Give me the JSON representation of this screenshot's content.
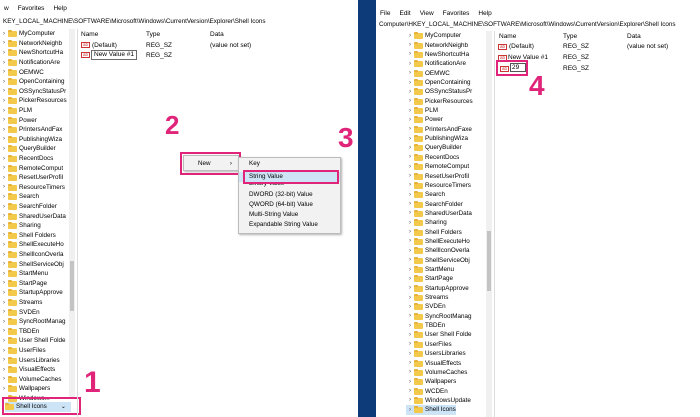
{
  "left": {
    "menu": [
      "w",
      "Favorites",
      "Help"
    ],
    "address": "KEY_LOCAL_MACHINE\\SOFTWARE\\Microsoft\\Windows\\CurrentVersion\\Explorer\\Shell Icons",
    "tree": [
      "MyComputer",
      "NetworkNeighb",
      "NewShortcutHa",
      "NotificationAre",
      "OEMWC",
      "OpenContaining",
      "OSSyncStatusPr",
      "PickerResources",
      "PLM",
      "Power",
      "PrintersAndFax",
      "PublishingWiza",
      "QueryBuilder",
      "RecentDocs",
      "RemoteComput",
      "ResetUserProfil",
      "ResourceTimers",
      "Search",
      "SearchFolder",
      "SharedUserData",
      "Sharing",
      "Shell Folders",
      "ShellExecuteHo",
      "ShellIconOverla",
      "ShellServiceObj",
      "StartMenu",
      "StartPage",
      "StartupApprove",
      "Streams",
      "SVDEn",
      "SyncRootManag",
      "TBDEn",
      "User Shell Folde",
      "UserFiles",
      "UsersLibraries",
      "VisualEffects",
      "VolumeCaches",
      "Wallpapers",
      "Windows..."
    ],
    "selected": "Shell Icons",
    "headers": {
      "name": "Name",
      "type": "Type",
      "data": "Data"
    },
    "rows": [
      {
        "name": "(Default)",
        "type": "REG_SZ",
        "data": "(value not set)"
      },
      {
        "name": "New Value #1",
        "type": "REG_SZ",
        "data": ""
      }
    ]
  },
  "context_menu": {
    "new_label": "New",
    "arrow": "›",
    "submenu": [
      "Key",
      "String Value",
      "Binary Value",
      "DWORD (32-bit) Value",
      "QWORD (64-bit) Value",
      "Multi-String Value",
      "Expandable String Value"
    ]
  },
  "right": {
    "menu": [
      "File",
      "Edit",
      "View",
      "Favorites",
      "Help"
    ],
    "address": "Computer\\HKEY_LOCAL_MACHINE\\SOFTWARE\\Microsoft\\Windows\\CurrentVersion\\Explorer\\Shell Icons",
    "tree": [
      "MyComputer",
      "NetworkNeighb",
      "NewShortcutHa",
      "NotificationAre",
      "OEMWC",
      "OpenContaining",
      "OSSyncStatusPr",
      "PickerResources",
      "PLM",
      "Power",
      "PrintersAndFaxe",
      "PublishingWiza",
      "QueryBuilder",
      "RecentDocs",
      "RemoteComput",
      "ResetUserProfil",
      "ResourceTimers",
      "Search",
      "SearchFolder",
      "SharedUserData",
      "Sharing",
      "Shell Folders",
      "ShellExecuteHo",
      "ShellIconOverla",
      "ShellServiceObj",
      "StartMenu",
      "StartPage",
      "StartupApprove",
      "Streams",
      "SVDEn",
      "SyncRootManag",
      "TBDEn",
      "User Shell Folde",
      "UserFiles",
      "UsersLibraries",
      "VisualEffects",
      "VolumeCaches",
      "Wallpapers",
      "WCDEn",
      "WindowsUpdate",
      "Shell Icons"
    ],
    "headers": {
      "name": "Name",
      "type": "Type",
      "data": "Data"
    },
    "rows": [
      {
        "name": "(Default)",
        "type": "REG_SZ",
        "data": "(value not set)"
      },
      {
        "name": "New Value #1",
        "type": "REG_SZ",
        "data": ""
      },
      {
        "name": "29",
        "type": "REG_SZ",
        "data": ""
      }
    ]
  },
  "steps": [
    "1",
    "2",
    "3",
    "4"
  ],
  "colors": {
    "annotation": "#e0247a",
    "background": "#0d3b7a",
    "folder": "#f3c94b"
  }
}
